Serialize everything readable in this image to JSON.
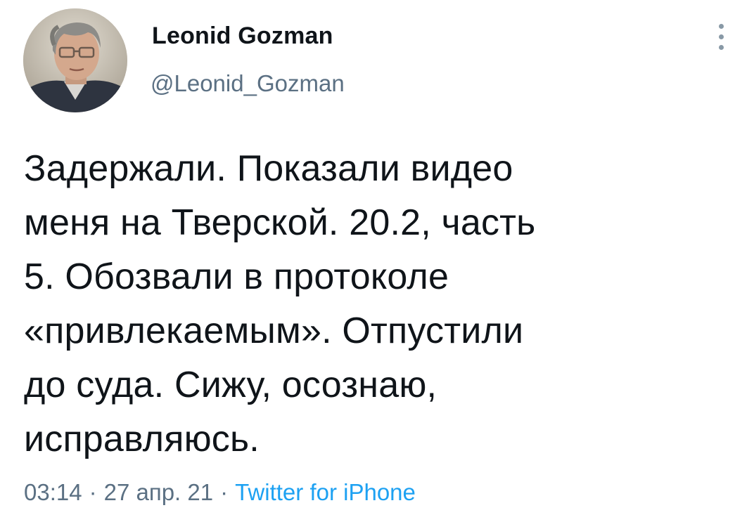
{
  "author": {
    "name": "Leonid Gozman",
    "handle": "@Leonid_Gozman"
  },
  "tweet": {
    "lines": [
      "Задержали. Показали видео",
      "меня на Тверской. 20.2, часть",
      "5. Обозвали в протоколе",
      "«привлекаемым». Отпустили",
      "до суда. Сижу, осознаю,",
      "исправляюсь."
    ]
  },
  "meta": {
    "time": "03:14",
    "separator": "·",
    "date": "27 апр. 21",
    "source": "Twitter for iPhone"
  },
  "colors": {
    "text": "#0f1419",
    "secondary": "#5b7083",
    "link": "#1da1f2",
    "more_icon": "#8899a6"
  },
  "icons": {
    "more": "vertical-ellipsis-icon"
  }
}
